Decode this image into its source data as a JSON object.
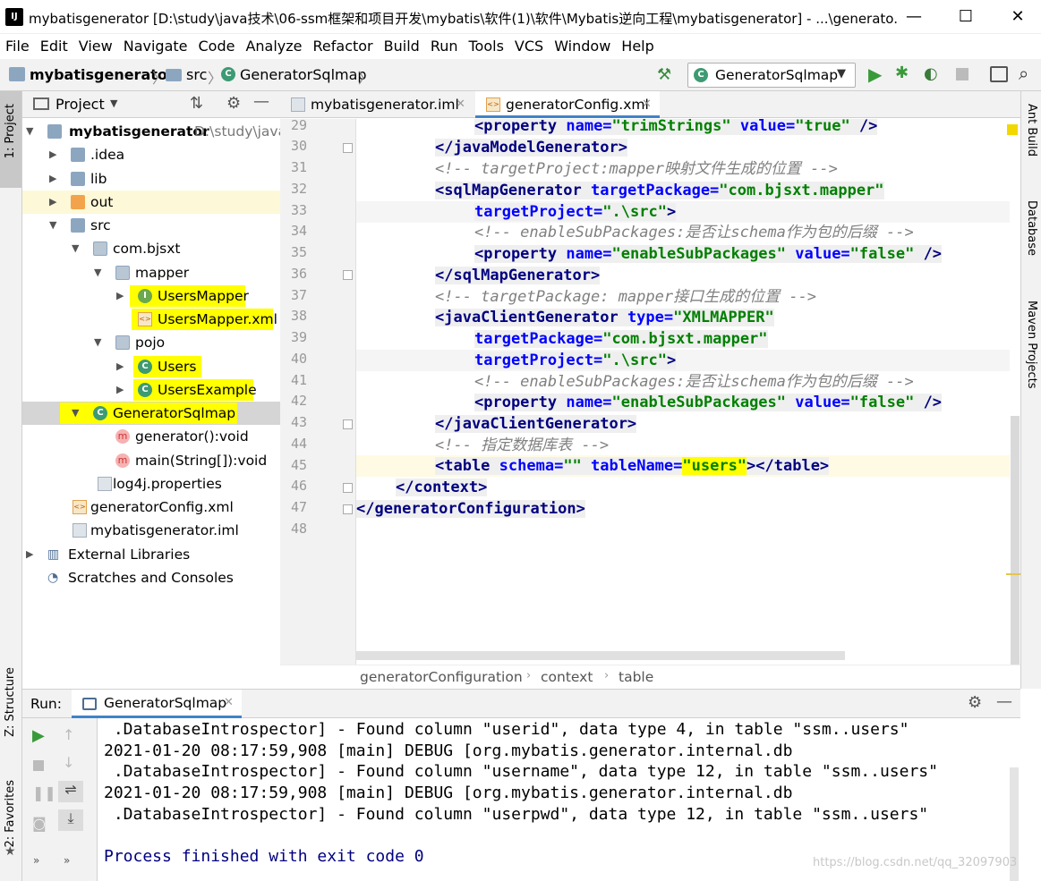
{
  "window": {
    "title": "mybatisgenerator [D:\\study\\java技术\\06-ssm框架和项目开发\\mybatis\\软件(1)\\软件\\Mybatis逆向工程\\mybatisgenerator] - ...\\generato...",
    "logo": "IJ",
    "minimize": "—",
    "maximize": "☐",
    "close": "✕"
  },
  "menu": [
    "File",
    "Edit",
    "View",
    "Navigate",
    "Code",
    "Analyze",
    "Refactor",
    "Build",
    "Run",
    "Tools",
    "VCS",
    "Window",
    "Help"
  ],
  "breadcrumb": {
    "project": "mybatisgenerator",
    "folder": "src",
    "file": "GeneratorSqlmap",
    "sep": "〉"
  },
  "run_config": {
    "selected": "GeneratorSqlmap"
  },
  "left_strip": {
    "project": "1: Project",
    "structure": "Z: Structure",
    "favorites": "2: Favorites"
  },
  "right_strip": {
    "ant": "Ant Build",
    "database": "Database",
    "maven": "Maven Projects"
  },
  "project_panel": {
    "title": "Project"
  },
  "tree": {
    "root_name": "mybatisgenerator",
    "root_path": "D:\\study\\java",
    "idea": ".idea",
    "lib": "lib",
    "out": "out",
    "src": "src",
    "pkg": "com.bjsxt",
    "mapper": "mapper",
    "users_mapper": "UsersMapper",
    "users_mapper_xml": "UsersMapper.xml",
    "pojo": "pojo",
    "users": "Users",
    "users_example": "UsersExample",
    "generator": "GeneratorSqlmap",
    "m_generator": "generator():void",
    "m_main": "main(String[]):void",
    "log4j": "log4j.properties",
    "gen_config": "generatorConfig.xml",
    "iml": "mybatisgenerator.iml",
    "ext_libs": "External Libraries",
    "scratches": "Scratches and Consoles"
  },
  "tabs": [
    "mybatisgenerator.iml",
    "generatorConfig.xml"
  ],
  "editor": {
    "lines": [
      "29",
      "30",
      "31",
      "32",
      "33",
      "34",
      "35",
      "36",
      "37",
      "38",
      "39",
      "40",
      "41",
      "42",
      "43",
      "44",
      "45",
      "46",
      "47",
      "48"
    ],
    "l29_a": "<property",
    "l29_b": " name=",
    "l29_c": "\"trimStrings\"",
    "l29_d": " value=",
    "l29_e": "\"true\"",
    "l29_f": " />",
    "l30": "</javaModelGenerator>",
    "l31": "<!-- targetProject:mapper映射文件生成的位置 -->",
    "l32_a": "<sqlMapGenerator",
    "l32_b": " targetPackage=",
    "l32_c": "\"com.bjsxt.mapper\"",
    "l33_a": "targetProject=",
    "l33_b": "\".\\src\"",
    "l33_c": ">",
    "l34": "<!-- enableSubPackages:是否让schema作为包的后缀 -->",
    "l35_a": "<property",
    "l35_b": " name=",
    "l35_c": "\"enableSubPackages\"",
    "l35_d": " value=",
    "l35_e": "\"false\"",
    "l35_f": " />",
    "l36": "</sqlMapGenerator>",
    "l37": "<!-- targetPackage: mapper接口生成的位置 -->",
    "l38_a": "<javaClientGenerator",
    "l38_b": " type=",
    "l38_c": "\"XMLMAPPER\"",
    "l39_a": "targetPackage=",
    "l39_b": "\"com.bjsxt.mapper\"",
    "l40_a": "targetProject=",
    "l40_b": "\".\\src\"",
    "l40_c": ">",
    "l41": "<!-- enableSubPackages:是否让schema作为包的后缀 -->",
    "l42_a": "<property",
    "l42_b": " name=",
    "l42_c": "\"enableSubPackages\"",
    "l42_d": " value=",
    "l42_e": "\"false\"",
    "l42_f": " />",
    "l43": "</javaClientGenerator>",
    "l44": "<!-- 指定数据库表 -->",
    "l45_a": "<table",
    "l45_b": " schema=",
    "l45_c": "\"\"",
    "l45_d": " tableName=",
    "l45_e": "\"users\"",
    "l45_f": "></table>",
    "l46": "</context>",
    "l47": "</generatorConfiguration>"
  },
  "editor_breadcrumb": [
    "generatorConfiguration",
    "context",
    "table"
  ],
  "run": {
    "label": "Run:",
    "tab": "GeneratorSqlmap",
    "console": [
      " .DatabaseIntrospector] - Found column \"userid\", data type 4, in table \"ssm..users\"",
      "2021-01-20 08:17:59,908 [main] DEBUG [org.mybatis.generator.internal.db",
      " .DatabaseIntrospector] - Found column \"username\", data type 12, in table \"ssm..users\"",
      "2021-01-20 08:17:59,908 [main] DEBUG [org.mybatis.generator.internal.db",
      " .DatabaseIntrospector] - Found column \"userpwd\", data type 12, in table \"ssm..users\"",
      "",
      "Process finished with exit code 0"
    ]
  },
  "watermark": "https://blog.csdn.net/qq_32097903",
  "colors": {
    "highlight": "#ffff00",
    "tag": "#000080",
    "attr": "#0000ff",
    "value": "#008000",
    "comment": "#808080",
    "exit": "#000080"
  }
}
